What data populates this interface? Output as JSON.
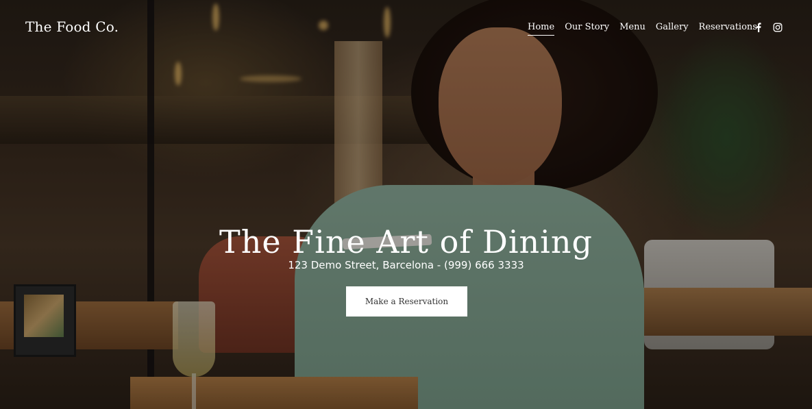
{
  "header": {
    "logo": "The Food Co.",
    "nav": [
      {
        "label": "Home",
        "active": true
      },
      {
        "label": "Our Story",
        "active": false
      },
      {
        "label": "Menu",
        "active": false
      },
      {
        "label": "Gallery",
        "active": false
      },
      {
        "label": "Reservations",
        "active": false
      }
    ],
    "social": [
      "facebook-icon",
      "instagram-icon"
    ]
  },
  "hero": {
    "title": "The Fine Art of Dining",
    "subtitle": "123 Demo Street, Barcelona - (999) 666 3333",
    "cta_label": "Make a Reservation"
  },
  "colors": {
    "text": "#ffffff",
    "button_bg": "#ffffff",
    "button_text": "#333333"
  }
}
